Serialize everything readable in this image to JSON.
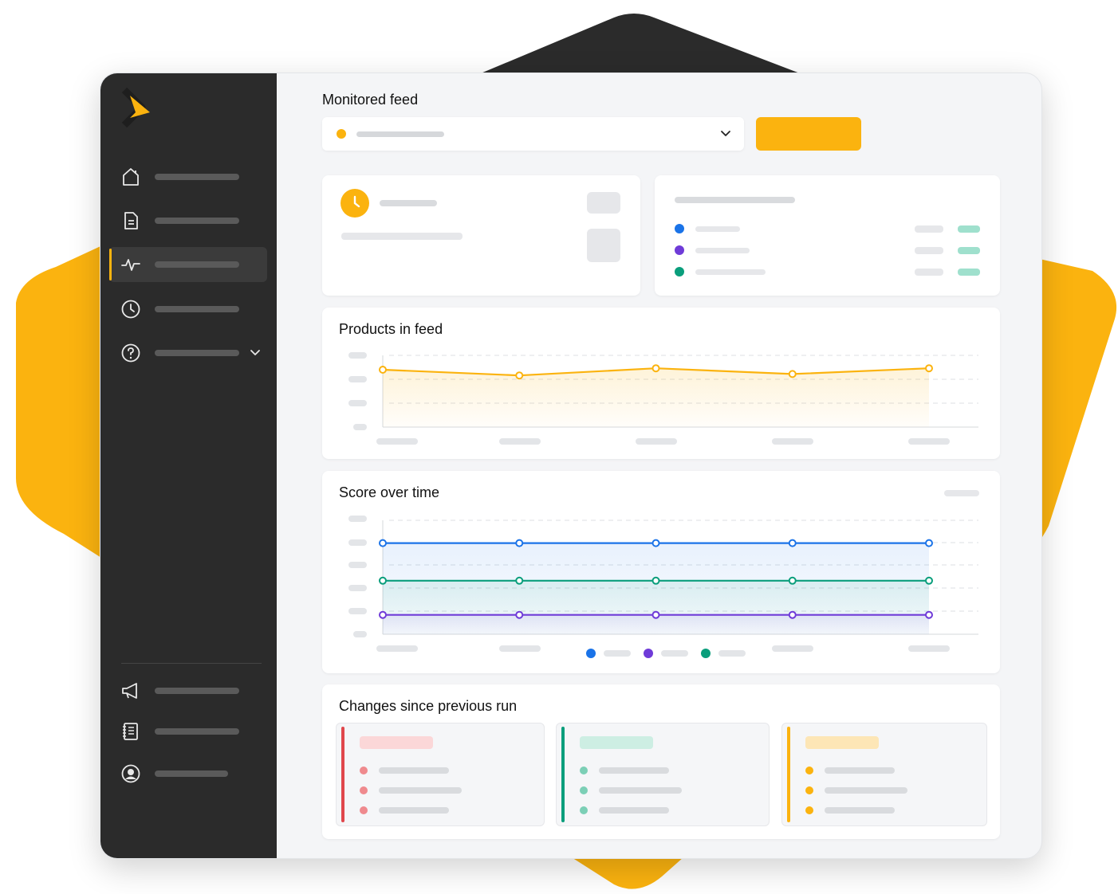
{
  "colors": {
    "accent": "#fbb30f",
    "sidebar_bg": "#2b2b2b",
    "blue": "#1a73e8",
    "purple": "#6f3bd8",
    "green": "#0a9e7c",
    "red": "#e0474c"
  },
  "sidebar": {
    "logo_icon": "chevron-right-logo-icon",
    "items": [
      {
        "icon": "home-icon"
      },
      {
        "icon": "document-icon"
      },
      {
        "icon": "activity-icon",
        "active": true
      },
      {
        "icon": "clock-icon"
      },
      {
        "icon": "help-icon",
        "expandable": true
      }
    ],
    "bottom_items": [
      {
        "icon": "megaphone-icon"
      },
      {
        "icon": "notebook-icon"
      },
      {
        "icon": "account-icon"
      }
    ]
  },
  "header": {
    "title": "Monitored feed",
    "feed_select_icon": "chevron-down-icon"
  },
  "status_card": {
    "icon": "clock-icon"
  },
  "score_card": {
    "dot_colors": [
      "#1a73e8",
      "#6f3bd8",
      "#0a9e7c"
    ]
  },
  "products_chart": {
    "title": "Products in feed",
    "chart_data": {
      "type": "area",
      "series": [
        {
          "color": "#fbb30f",
          "values": [
            0.8,
            0.72,
            0.82,
            0.74,
            0.82
          ]
        }
      ],
      "ylim": [
        0,
        1
      ],
      "grid": true,
      "legend": "none"
    }
  },
  "score_chart": {
    "title": "Score over time",
    "chart_data": {
      "type": "line",
      "series": [
        {
          "color": "#1a73e8",
          "values": [
            0.8,
            0.8,
            0.8,
            0.8,
            0.8
          ]
        },
        {
          "color": "#0a9e7c",
          "values": [
            0.47,
            0.47,
            0.47,
            0.47,
            0.47
          ]
        },
        {
          "color": "#6f3bd8",
          "values": [
            0.17,
            0.17,
            0.17,
            0.17,
            0.17
          ]
        }
      ],
      "ylim": [
        0,
        1
      ],
      "grid": true,
      "legend": "bottom"
    }
  },
  "changes": {
    "title": "Changes since previous run",
    "groups": [
      {
        "accent": "#e0474c",
        "head": "#fbd7d8",
        "dot": "#ef8a8e"
      },
      {
        "accent": "#0a9e7c",
        "head": "#cdeee3",
        "dot": "#7ccfb6"
      },
      {
        "accent": "#fbb30f",
        "head": "#fde6b6",
        "dot": "#fbb30f"
      }
    ]
  }
}
